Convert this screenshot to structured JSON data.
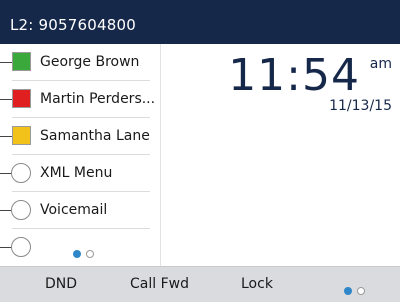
{
  "header": {
    "line_label": "L2: 9057604800"
  },
  "programmable_keys": [
    {
      "label": "George Brown",
      "indicator": "square",
      "color": "#3aa83a"
    },
    {
      "label": "Martin Perders...",
      "indicator": "square",
      "color": "#e02020"
    },
    {
      "label": "Samantha Lane",
      "indicator": "square",
      "color": "#f2c21a"
    },
    {
      "label": "XML Menu",
      "indicator": "circle"
    },
    {
      "label": "Voicemail",
      "indicator": "circle"
    },
    {
      "label": "",
      "indicator": "circle"
    }
  ],
  "key_page_indicator": {
    "current": 1,
    "total": 2
  },
  "clock": {
    "time": "11:54",
    "ampm": "am",
    "date": "11/13/15"
  },
  "softkeys": [
    {
      "label": "DND"
    },
    {
      "label": "Call Fwd"
    },
    {
      "label": "Lock"
    }
  ],
  "softkey_page_indicator": {
    "current": 1,
    "total": 2
  },
  "colors": {
    "header_bg": "#16284a",
    "accent": "#2f86c8",
    "softkey_bg": "#d9dbde"
  }
}
